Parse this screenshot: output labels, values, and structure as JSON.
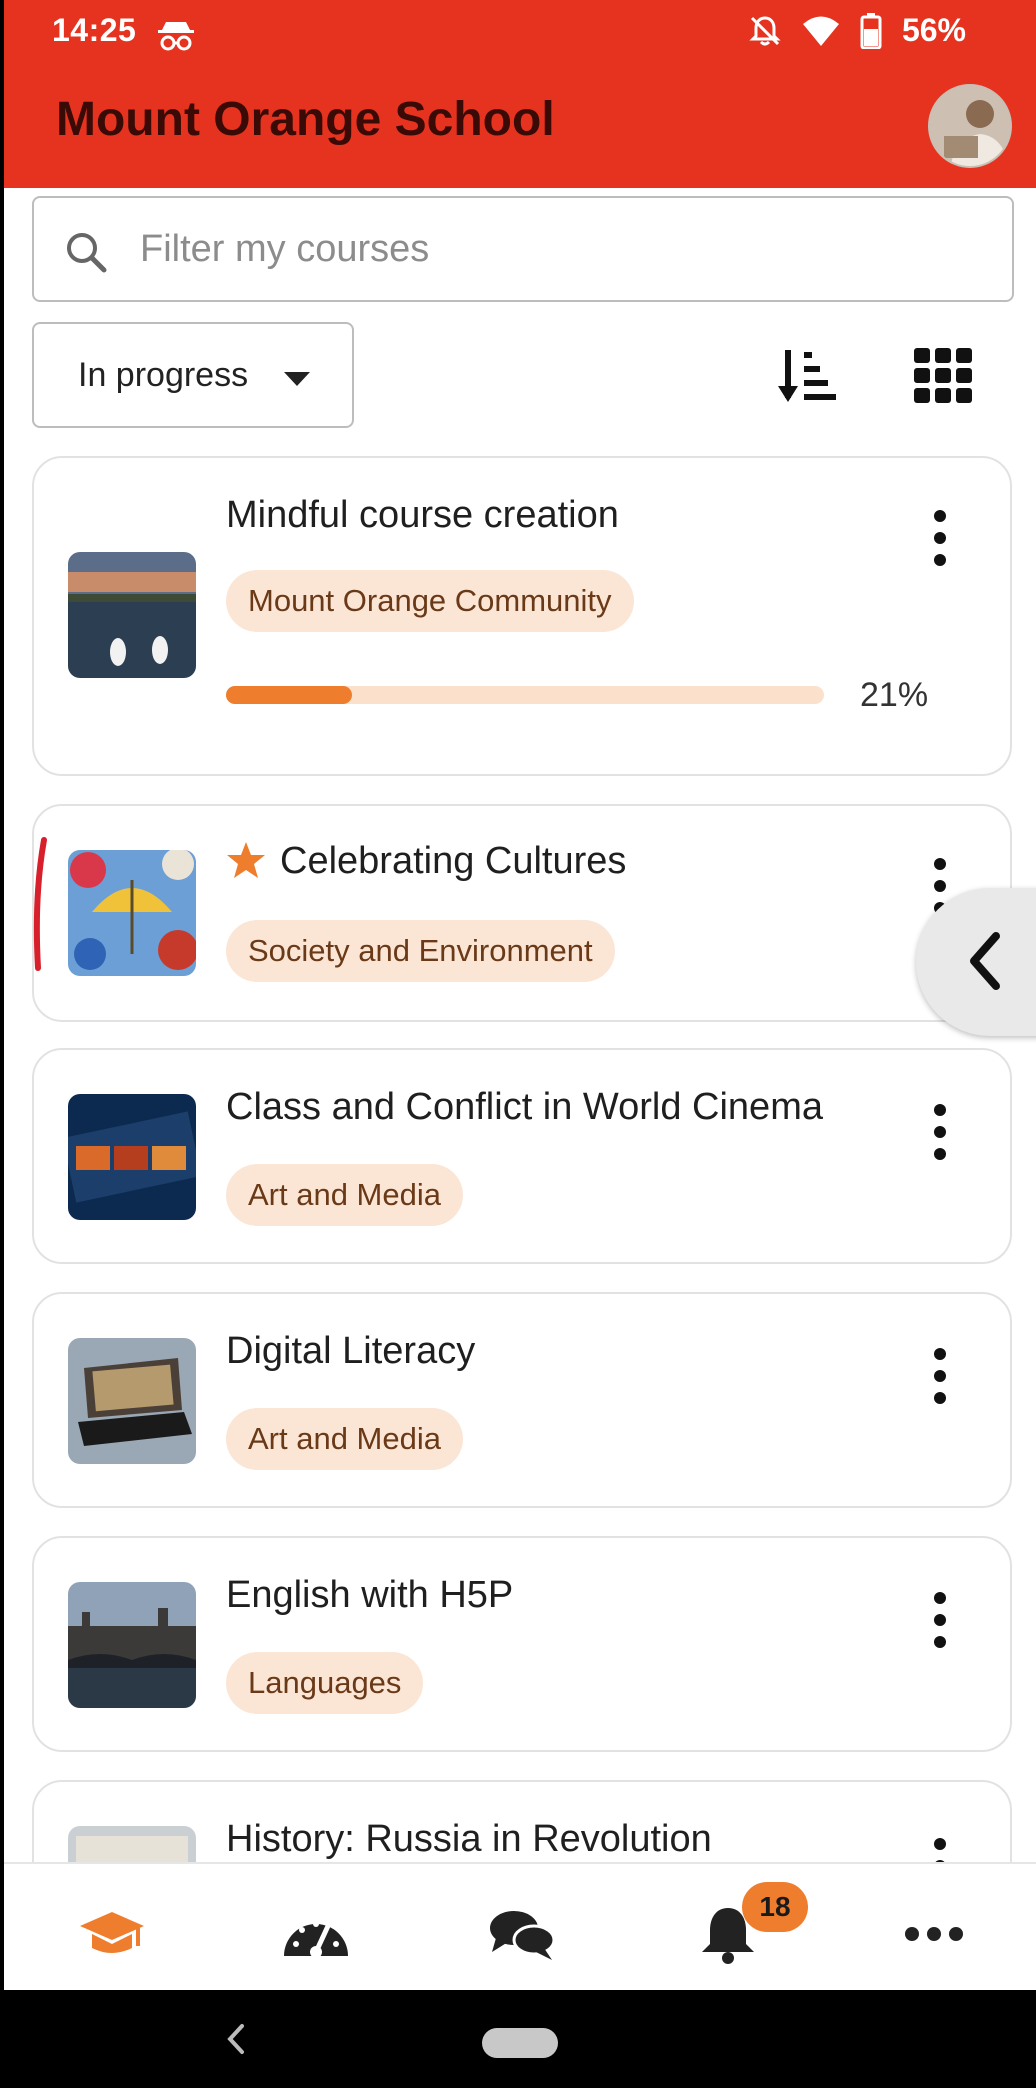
{
  "status_bar": {
    "time": "14:25",
    "battery": "56%"
  },
  "header": {
    "title": "Mount Orange School"
  },
  "search": {
    "placeholder": "Filter my courses"
  },
  "filter": {
    "selected": "In progress"
  },
  "courses": [
    {
      "title": "Mindful course creation",
      "category": "Mount Orange Community",
      "progress": 21,
      "progress_label": "21%",
      "starred": false
    },
    {
      "title": "Celebrating Cultures",
      "category": "Society and Environment",
      "starred": true
    },
    {
      "title": "Class and Conflict in World Cinema",
      "category": "Art and Media",
      "starred": false
    },
    {
      "title": "Digital Literacy",
      "category": "Art and Media",
      "starred": false
    },
    {
      "title": "English with H5P",
      "category": "Languages",
      "starred": false
    },
    {
      "title": "History: Russia in Revolution",
      "starred": false
    }
  ],
  "bottom_nav": {
    "items": [
      "graduation-cap-icon",
      "dashboard-gauge-icon",
      "messages-icon",
      "bell-icon",
      "more-icon"
    ],
    "notifications_count": "18"
  },
  "colors": {
    "brand": "#e5331f",
    "accent": "#ef7d2e",
    "pill_bg": "#fbe6d6"
  }
}
